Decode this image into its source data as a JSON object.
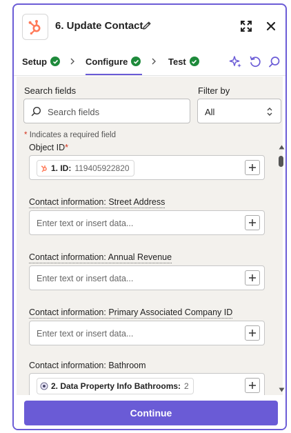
{
  "header": {
    "title": "6. Update Contact",
    "logo_icon": "hubspot-icon",
    "brand_color": "#ff7a59"
  },
  "tabs": [
    {
      "label": "Setup",
      "complete": true
    },
    {
      "label": "Configure",
      "complete": true,
      "active": true
    },
    {
      "label": "Test",
      "complete": true
    }
  ],
  "toolbar_icons": [
    "sparkle-icon",
    "refresh-icon",
    "search-icon"
  ],
  "search": {
    "label": "Search fields",
    "placeholder": "Search fields",
    "value": ""
  },
  "filter": {
    "label": "Filter by",
    "selected": "All"
  },
  "required_note": {
    "star": "*",
    "text": "Indicates a required field"
  },
  "fields": [
    {
      "label": "Object ID",
      "required": "*",
      "pill": {
        "label": "1. ID:",
        "value": "119405922820",
        "icon": "hubspot-icon"
      }
    },
    {
      "label": "Contact information: Street Address",
      "placeholder": "Enter text or insert data..."
    },
    {
      "label": "Contact information: Annual Revenue",
      "placeholder": "Enter text or insert data..."
    },
    {
      "label": "Contact information: Primary Associated Company ID",
      "placeholder": "Enter text or insert data..."
    },
    {
      "label": "Contact information: Bathroom",
      "pill": {
        "label": "2. Data Property Info Bathrooms:",
        "value": "2",
        "icon": "data-icon"
      }
    }
  ],
  "footer": {
    "continue_label": "Continue"
  },
  "colors": {
    "accent": "#6a5bd6",
    "success": "#1e8a3b",
    "required": "#d4311b",
    "panel_bg": "#f3f1ed"
  }
}
